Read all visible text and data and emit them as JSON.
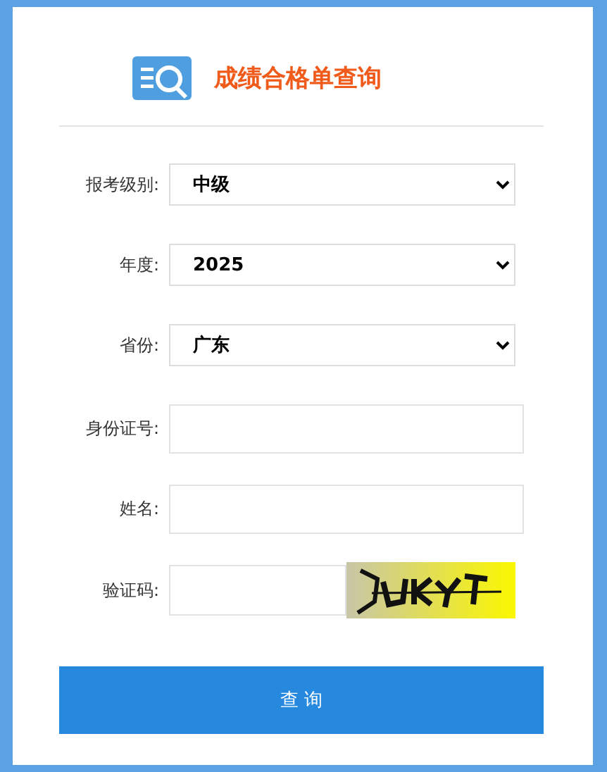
{
  "title": "成绩合格单查询",
  "fields": [
    {
      "kind": "select",
      "label": "报考级别:",
      "value": "中级"
    },
    {
      "kind": "select",
      "label": "年度:",
      "value": "2025"
    },
    {
      "kind": "select",
      "label": "省份:",
      "value": "广东"
    },
    {
      "kind": "input",
      "label": "身份证号:"
    },
    {
      "kind": "input",
      "label": "姓名:"
    },
    {
      "kind": "captcha",
      "label": "验证码:"
    }
  ],
  "submit": "查 询"
}
